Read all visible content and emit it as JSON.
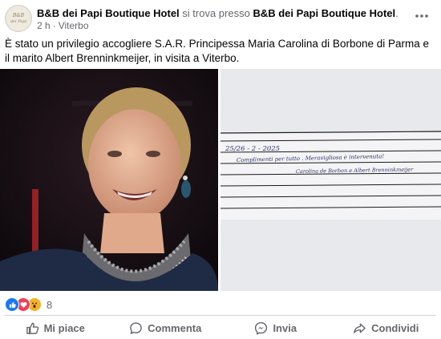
{
  "post": {
    "page_name": "B&B dei Papi Boutique Hotel",
    "connector": "si trova presso",
    "location_name": "B&B dei Papi Boutique Hotel",
    "location_suffix": ".",
    "time": "2 h",
    "separator": "·",
    "place": "Viterbo",
    "caption": "È stato un privilegio accogliere S.A.R. Principessa Maria Carolina di Borbone di Parma e il marito Albert Brenninkmeijer, in visita a Viterbo.",
    "avatar_text": "B&B dei Papi"
  },
  "guestbook": {
    "date": "25/26 - 2 - 2025",
    "line1": "Complimenti per tutto . Meravigliosa è intervenuta!",
    "line2": "Carolina de Borbon e Albert Brenninkmeijer"
  },
  "reactions": {
    "icons": [
      "like-icon",
      "love-icon",
      "wow-icon"
    ],
    "count": "8"
  },
  "actions": {
    "like": "Mi piace",
    "comment": "Commenta",
    "share_msg": "Invia",
    "share": "Condividi"
  },
  "colors": {
    "text": "#050505",
    "secondary": "#65676b",
    "like_blue": "#1877f2",
    "love_red": "#f33e58",
    "wow_yellow": "#f7b125"
  }
}
